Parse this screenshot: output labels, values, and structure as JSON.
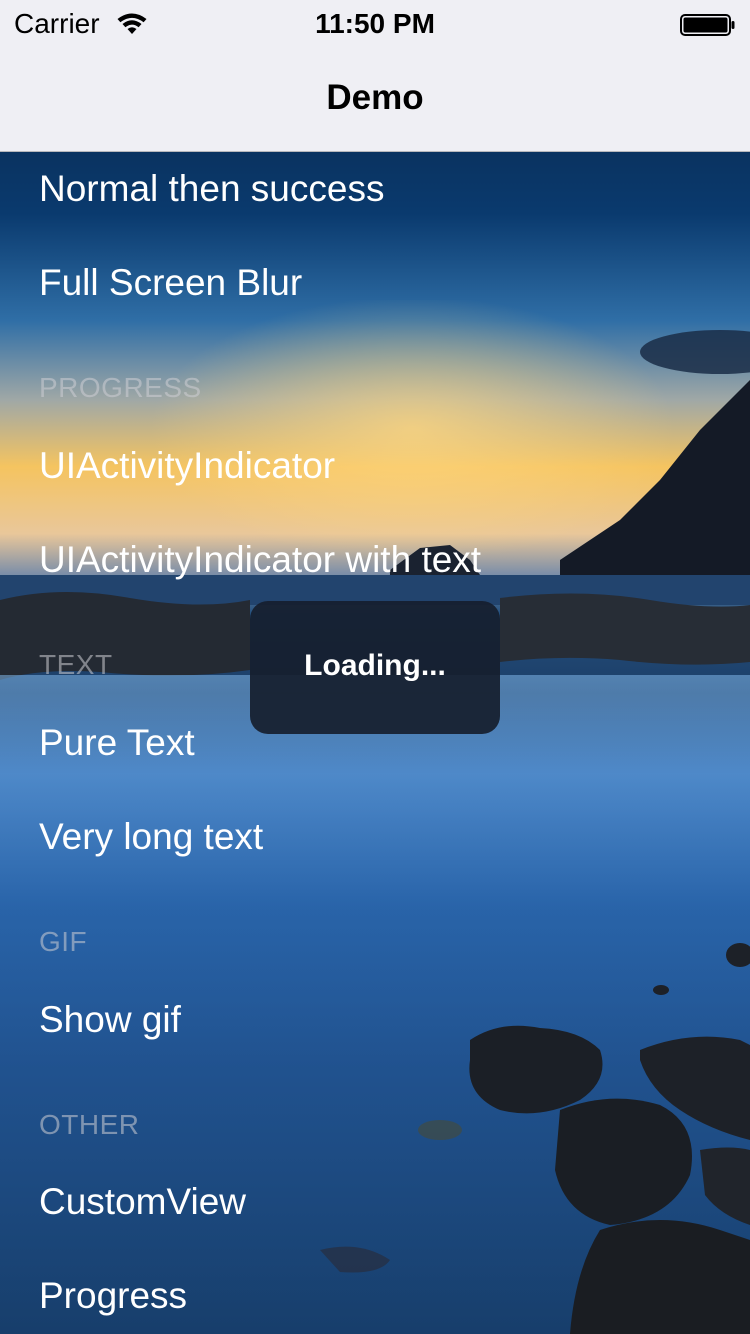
{
  "status_bar": {
    "carrier": "Carrier",
    "time": "11:50 PM",
    "wifi_icon": "wifi-icon",
    "battery_icon": "battery-full-icon"
  },
  "nav_bar": {
    "title": "Demo"
  },
  "table": {
    "rows_top": [
      {
        "label": "Normal then success"
      },
      {
        "label": "Full Screen Blur"
      }
    ],
    "sections": [
      {
        "header": "PROGRESS",
        "rows": [
          {
            "label": "UIActivityIndicator"
          },
          {
            "label": "UIActivityIndicator with text"
          }
        ]
      },
      {
        "header": "TEXT",
        "rows": [
          {
            "label": "Pure Text"
          },
          {
            "label": "Very long text"
          }
        ]
      },
      {
        "header": "GIF",
        "rows": [
          {
            "label": "Show gif"
          }
        ]
      },
      {
        "header": "OTHER",
        "rows": [
          {
            "label": "CustomView"
          },
          {
            "label": "Progress"
          }
        ]
      }
    ]
  },
  "hud": {
    "text": "Loading..."
  },
  "colors": {
    "nav_background": "#efeff4",
    "row_text": "#ffffff",
    "section_header_text": "#a8a8b0",
    "hud_background": "#161e2e"
  }
}
